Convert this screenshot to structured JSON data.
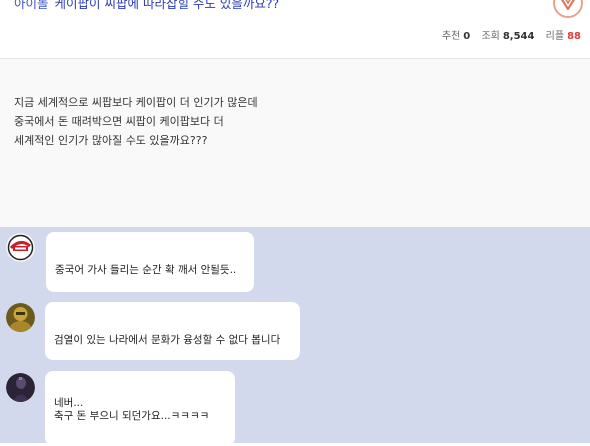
{
  "post": {
    "category": "아이돌",
    "title": "케이팝이 씨팝에 따라잡힐 수도 있을까요??",
    "stats": {
      "recommend_label": "추천",
      "recommend": "0",
      "views_label": "조회",
      "views": "8,544",
      "replies_label": "리플",
      "replies": "88"
    },
    "body_lines": [
      "지금 세계적으로 씨팝보다 케이팝이 더 인기가 많은데",
      "중국에서 돈 때려박으면 씨팝이 케이팝보다 더",
      "세계적인 인기가 많아질 수도 있을까요???"
    ]
  },
  "comments": [
    {
      "avatar": "baseball-team-logo",
      "lines": [
        "중국어 가사 들리는 순간 확 깨서 안될듯.."
      ]
    },
    {
      "avatar": "golden-armor-character",
      "lines": [
        "검열이 있는 나라에서 문화가 융성할 수 없다 봅니다"
      ]
    },
    {
      "avatar": "dark-figure-portrait",
      "lines": [
        "네버...",
        "축구 돈 부으니 되던가요...ㅋㅋㅋㅋ"
      ]
    }
  ],
  "colors": {
    "title": "#2b3cb8",
    "replies_count": "#e03c3c",
    "comment_area_bg": "#d3d9ec",
    "bubble_bg": "#ffffff"
  }
}
